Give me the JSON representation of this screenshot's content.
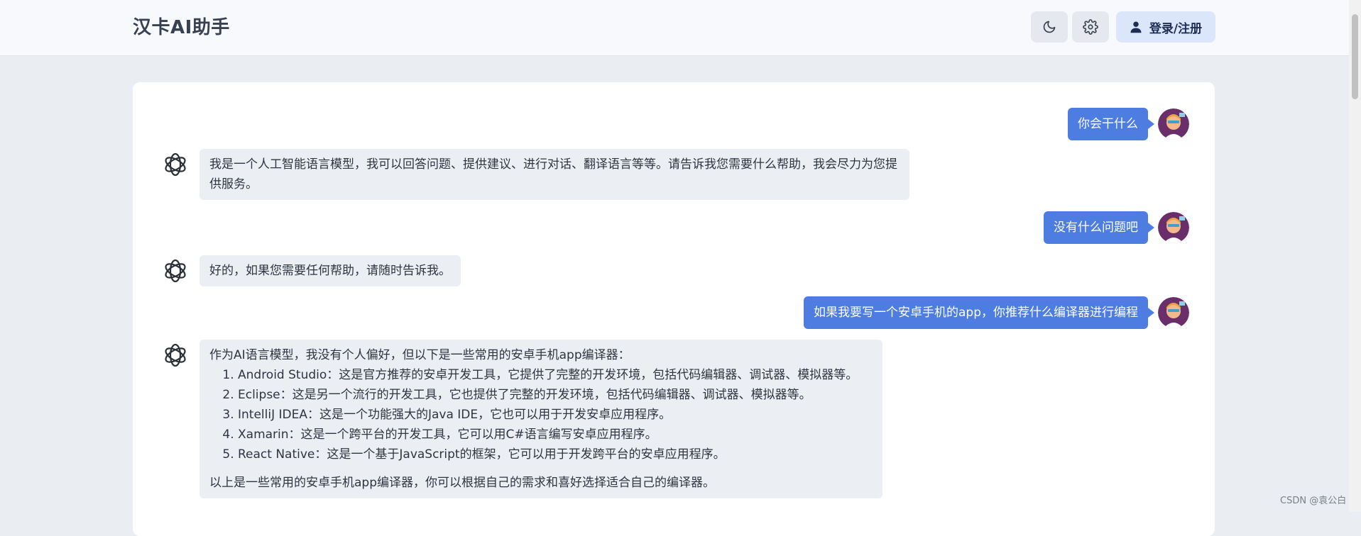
{
  "header": {
    "title": "汉卡AI助手",
    "dark_mode_icon": "moon-icon",
    "settings_icon": "gear-icon",
    "login_icon": "user-icon",
    "login_label": "登录/注册"
  },
  "conversation": {
    "messages": [
      {
        "role": "user",
        "text": "你会干什么"
      },
      {
        "role": "assistant",
        "text": "我是一个人工智能语言模型，我可以回答问题、提供建议、进行对话、翻译语言等等。请告诉我您需要什么帮助，我会尽力为您提供服务。"
      },
      {
        "role": "user",
        "text": "没有什么问题吧"
      },
      {
        "role": "assistant",
        "text": "好的，如果您需要任何帮助，请随时告诉我。"
      },
      {
        "role": "user",
        "text": "如果我要写一个安卓手机的app，你推荐什么编译器进行编程"
      },
      {
        "role": "assistant",
        "intro": "作为AI语言模型，我没有个人偏好，但以下是一些常用的安卓手机app编译器：",
        "items": [
          "Android Studio：这是官方推荐的安卓开发工具，它提供了完整的开发环境，包括代码编辑器、调试器、模拟器等。",
          "Eclipse：这是另一个流行的开发工具，它也提供了完整的开发环境，包括代码编辑器、调试器、模拟器等。",
          "IntelliJ IDEA：这是一个功能强大的Java IDE，它也可以用于开发安卓应用程序。",
          "Xamarin：这是一个跨平台的开发工具，它可以用C#语言编写安卓应用程序。",
          "React Native：这是一个基于JavaScript的框架，它可以用于开发跨平台的安卓应用程序。"
        ],
        "outro": "以上是一些常用的安卓手机app编译器，你可以根据自己的需求和喜好选择适合自己的编译器。"
      }
    ]
  },
  "watermark": "CSDN @袁公白",
  "colors": {
    "user_bubble": "#4d7de0",
    "bot_bubble": "#ebeef3",
    "login_button": "#dbe6fb"
  }
}
